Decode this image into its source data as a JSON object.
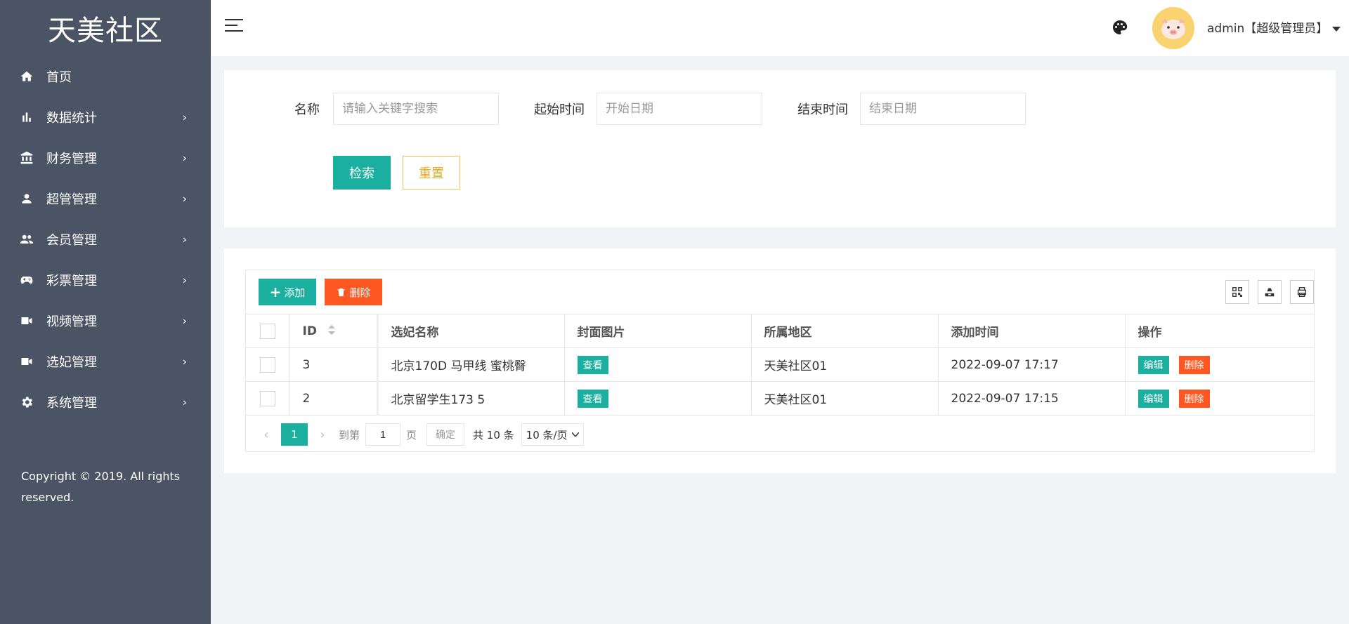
{
  "sidebar": {
    "logo": "天美社区",
    "items": [
      {
        "label": "首页",
        "icon": "home-icon"
      },
      {
        "label": "数据统计",
        "icon": "bar-chart-icon"
      },
      {
        "label": "财务管理",
        "icon": "bank-icon"
      },
      {
        "label": "超管管理",
        "icon": "user-icon"
      },
      {
        "label": "会员管理",
        "icon": "users-icon"
      },
      {
        "label": "彩票管理",
        "icon": "gamepad-icon"
      },
      {
        "label": "视频管理",
        "icon": "video-icon"
      },
      {
        "label": "选妃管理",
        "icon": "video-icon"
      },
      {
        "label": "系统管理",
        "icon": "gear-icon"
      }
    ],
    "chevron": "›",
    "copyright": "Copyright © 2019. All rights reserved."
  },
  "header": {
    "user": "admin【超级管理员】",
    "accent": "#1aaf9e"
  },
  "search": {
    "name_label": "名称",
    "name_placeholder": "请输入关键字搜索",
    "start_label": "起始时间",
    "start_placeholder": "开始日期",
    "end_label": "结束时间",
    "end_placeholder": "结束日期",
    "search_btn": "检索",
    "reset_btn": "重置"
  },
  "toolbar": {
    "add_label": "添加",
    "delete_label": "删除"
  },
  "table": {
    "columns": [
      "ID",
      "选妃名称",
      "封面图片",
      "所属地区",
      "添加时间",
      "操作"
    ],
    "rows": [
      {
        "id": "3",
        "name": "北京170D 马甲线 蜜桃臀",
        "cover": "查看",
        "region": "天美社区01",
        "time": "2022-09-07 17:17",
        "edit": "编辑",
        "del": "删除"
      },
      {
        "id": "2",
        "name": "北京留学生173 5",
        "cover": "查看",
        "region": "天美社区01",
        "time": "2022-09-07 17:15",
        "edit": "编辑",
        "del": "删除"
      }
    ]
  },
  "pager": {
    "current": "1",
    "goto_label": "到第",
    "page_input": "1",
    "page_unit": "页",
    "confirm": "确定",
    "total": "共 10 条",
    "page_size": "10 条/页"
  }
}
